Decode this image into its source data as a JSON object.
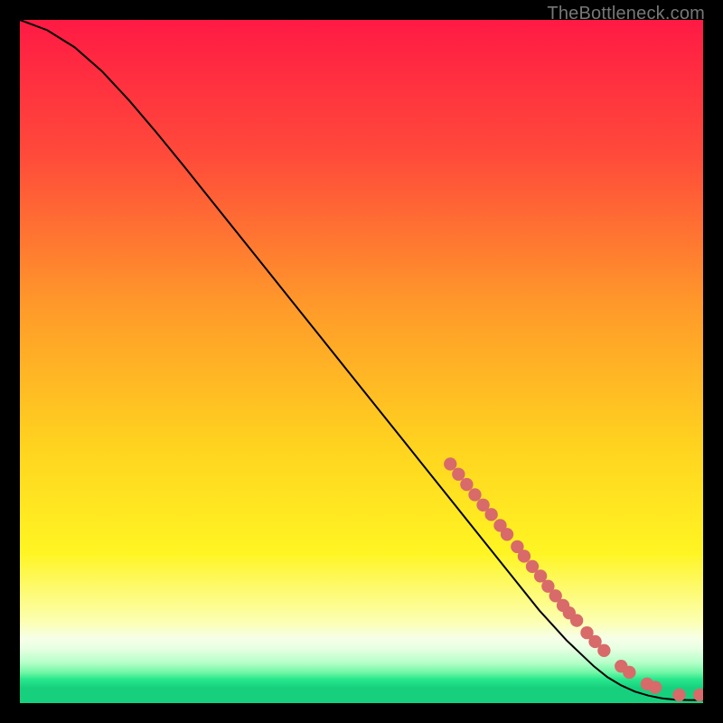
{
  "attribution": "TheBottleneck.com",
  "colors": {
    "frame": "#000000",
    "line": "#000000",
    "marker": "#d86a6a",
    "gradient_stops": [
      {
        "offset": 0.0,
        "color": "#ff1a44"
      },
      {
        "offset": 0.2,
        "color": "#ff4b3a"
      },
      {
        "offset": 0.42,
        "color": "#ff9a2a"
      },
      {
        "offset": 0.62,
        "color": "#ffd21f"
      },
      {
        "offset": 0.78,
        "color": "#fff523"
      },
      {
        "offset": 0.88,
        "color": "#fcffb0"
      },
      {
        "offset": 0.905,
        "color": "#f6ffe8"
      },
      {
        "offset": 0.92,
        "color": "#e7ffe2"
      },
      {
        "offset": 0.94,
        "color": "#b8ffca"
      },
      {
        "offset": 0.955,
        "color": "#72f7a6"
      },
      {
        "offset": 0.965,
        "color": "#28e78c"
      },
      {
        "offset": 0.978,
        "color": "#16d07e"
      },
      {
        "offset": 1.0,
        "color": "#16d07e"
      }
    ]
  },
  "chart_data": {
    "type": "line",
    "title": "",
    "xlabel": "",
    "ylabel": "",
    "xlim": [
      0,
      100
    ],
    "ylim": [
      0,
      100
    ],
    "grid": false,
    "series": [
      {
        "name": "curve",
        "x": [
          0,
          4,
          8,
          12,
          16,
          20,
          24,
          28,
          32,
          36,
          40,
          44,
          48,
          52,
          56,
          60,
          64,
          68,
          72,
          76,
          80,
          84,
          86,
          88,
          90,
          92,
          94,
          96,
          98,
          100
        ],
        "y": [
          100,
          98.5,
          96.0,
          92.5,
          88.2,
          83.5,
          78.6,
          73.6,
          68.6,
          63.6,
          58.6,
          53.6,
          48.6,
          43.6,
          38.6,
          33.6,
          28.6,
          23.6,
          18.6,
          13.6,
          9.2,
          5.4,
          3.8,
          2.6,
          1.7,
          1.1,
          0.7,
          0.5,
          0.45,
          0.45
        ]
      }
    ],
    "markers": [
      {
        "x": 63.0,
        "y": 35.0
      },
      {
        "x": 64.2,
        "y": 33.5
      },
      {
        "x": 65.4,
        "y": 32.0
      },
      {
        "x": 66.6,
        "y": 30.5
      },
      {
        "x": 67.8,
        "y": 29.0
      },
      {
        "x": 69.0,
        "y": 27.6
      },
      {
        "x": 70.3,
        "y": 26.0
      },
      {
        "x": 71.3,
        "y": 24.7
      },
      {
        "x": 72.8,
        "y": 22.9
      },
      {
        "x": 73.8,
        "y": 21.5
      },
      {
        "x": 75.0,
        "y": 20.0
      },
      {
        "x": 76.2,
        "y": 18.6
      },
      {
        "x": 77.3,
        "y": 17.1
      },
      {
        "x": 78.4,
        "y": 15.7
      },
      {
        "x": 79.5,
        "y": 14.3
      },
      {
        "x": 80.4,
        "y": 13.2
      },
      {
        "x": 81.5,
        "y": 12.1
      },
      {
        "x": 83.0,
        "y": 10.3
      },
      {
        "x": 84.2,
        "y": 9.0
      },
      {
        "x": 85.5,
        "y": 7.7
      },
      {
        "x": 88.0,
        "y": 5.4
      },
      {
        "x": 89.2,
        "y": 4.5
      },
      {
        "x": 91.8,
        "y": 2.8
      },
      {
        "x": 93.0,
        "y": 2.3
      },
      {
        "x": 96.5,
        "y": 1.2
      },
      {
        "x": 99.5,
        "y": 1.2
      }
    ],
    "marker_radius_data_units": 0.95
  }
}
